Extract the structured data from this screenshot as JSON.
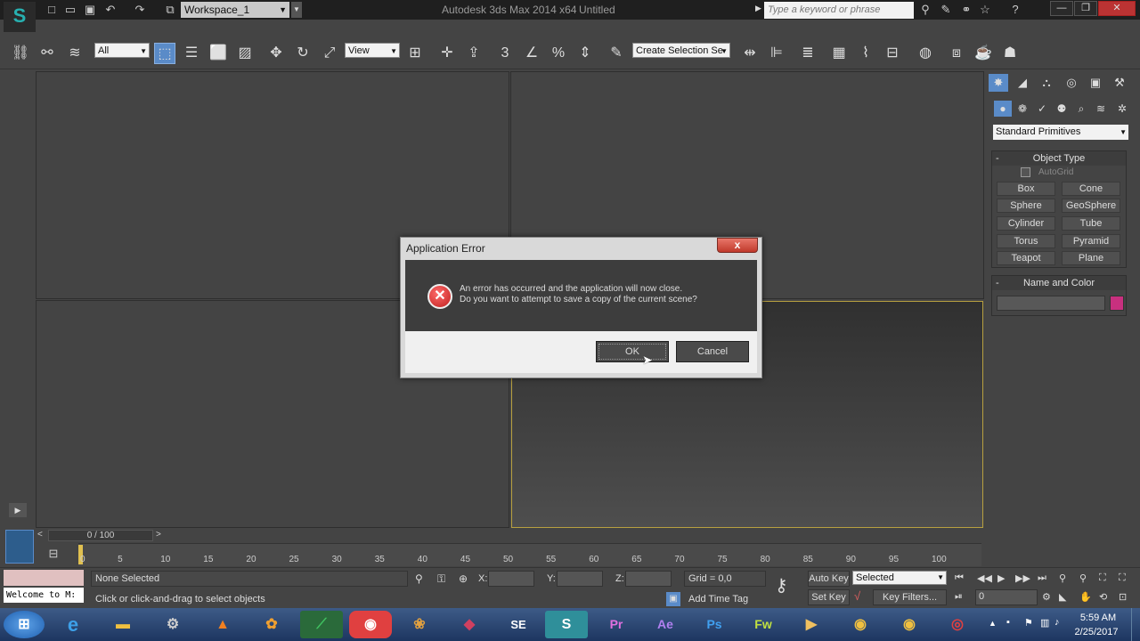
{
  "titlebar": {
    "workspace": "Workspace_1",
    "app_title": "Autodesk 3ds Max  2014 x64",
    "doc_title": "Untitled",
    "search_placeholder": "Type a keyword or phrase"
  },
  "toolbar": {
    "selection_filter": "All",
    "reference_coord": "View",
    "named_selection": "Create Selection Se",
    "snap_3": "3",
    "snap_pct": "%"
  },
  "command_panel": {
    "category": "Standard Primitives",
    "object_type_title": "Object Type",
    "autogrid_label": "AutoGrid",
    "primitives": [
      "Box",
      "Cone",
      "Sphere",
      "GeoSphere",
      "Cylinder",
      "Tube",
      "Torus",
      "Pyramid",
      "Teapot",
      "Plane"
    ],
    "name_color_title": "Name and Color",
    "minus": "-",
    "swatch_color": "#c8307f"
  },
  "dialog": {
    "title": "Application Error",
    "close": "x",
    "line1": "An error has occurred and the application will now close.",
    "line2": "Do you want to attempt to save a copy of the current scene?",
    "ok": "OK",
    "cancel": "Cancel"
  },
  "timeline": {
    "frame_counter": "0 / 100",
    "prev": "<",
    "next": ">",
    "ticks": [
      "0",
      "5",
      "10",
      "15",
      "20",
      "25",
      "30",
      "35",
      "40",
      "45",
      "50",
      "55",
      "60",
      "65",
      "70",
      "75",
      "80",
      "85",
      "90",
      "95",
      "100"
    ]
  },
  "status": {
    "maxscript_text": "Welcome to M:",
    "selection_status": "None Selected",
    "prompt": "Click or click-and-drag to select objects",
    "x_label": "X:",
    "y_label": "Y:",
    "z_label": "Z:",
    "grid": "Grid = 0,0",
    "add_time_tag": "Add Time Tag",
    "auto_key": "Auto Key",
    "set_key": "Set Key",
    "key_mode": "Selected",
    "key_filters": "Key Filters...",
    "current_frame": "0"
  },
  "taskbar": {
    "apps": [
      "windows-start",
      "internet-explorer",
      "file-explorer",
      "app-4",
      "vlc",
      "fl-studio",
      "sketchup",
      "app-8",
      "app-9",
      "app-10",
      "se",
      "3ds-max",
      "premiere",
      "after-effects",
      "photoshop",
      "fireworks",
      "app-17",
      "chrome",
      "chrome-2",
      "app-20"
    ],
    "time": "5:59 AM",
    "date": "2/25/2017"
  }
}
